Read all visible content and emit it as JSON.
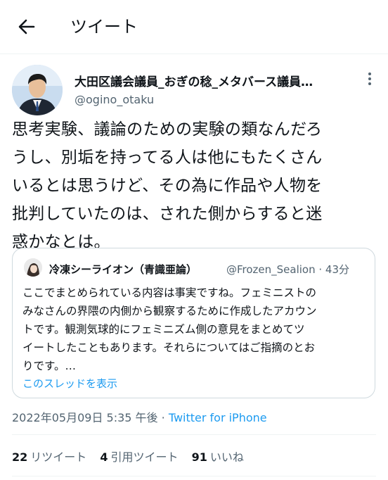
{
  "header": {
    "title": "ツイート",
    "back_icon": "arrow-left-icon"
  },
  "author": {
    "name": "大田区議会議員_おぎの稔_メタバース議員…",
    "handle": "@ogino_otaku",
    "avatar_icon": "avatar"
  },
  "tweet": {
    "text": "思考実験、議論のための実験の類なんだろ\nうし、別垢を持ってる人は他にもたくさん\nいるとは思うけど、その為に作品や人物を\n批判していたのは、された側からすると迷\n惑かなとは。"
  },
  "quote": {
    "name": "冷凍シーライオン（青識亜論）",
    "handle_time": "@Frozen_Sealion · 43分",
    "text": "ここでまとめられている内容は事実ですね。フェミニストの\nみなさんの界隈の内側から観察するために作成したアカウン\nトです。観測気球的にフェミニズム側の意見をまとめてツ\nイートしたこともあります。それらについてはご指摘のとお\nりです。…",
    "show_thread": "このスレッドを表示"
  },
  "meta": {
    "timestamp": "2022年05月09日 5:35 午後 · ",
    "source": "Twitter for iPhone"
  },
  "stats": {
    "retweets_count": "22",
    "retweets_label": "リツイート",
    "quotes_count": "4",
    "quotes_label": "引用ツイート",
    "likes_count": "91",
    "likes_label": "いいね"
  },
  "colors": {
    "link": "#1d9bf0",
    "secondary_text": "#536471",
    "border": "#cfd9de"
  }
}
